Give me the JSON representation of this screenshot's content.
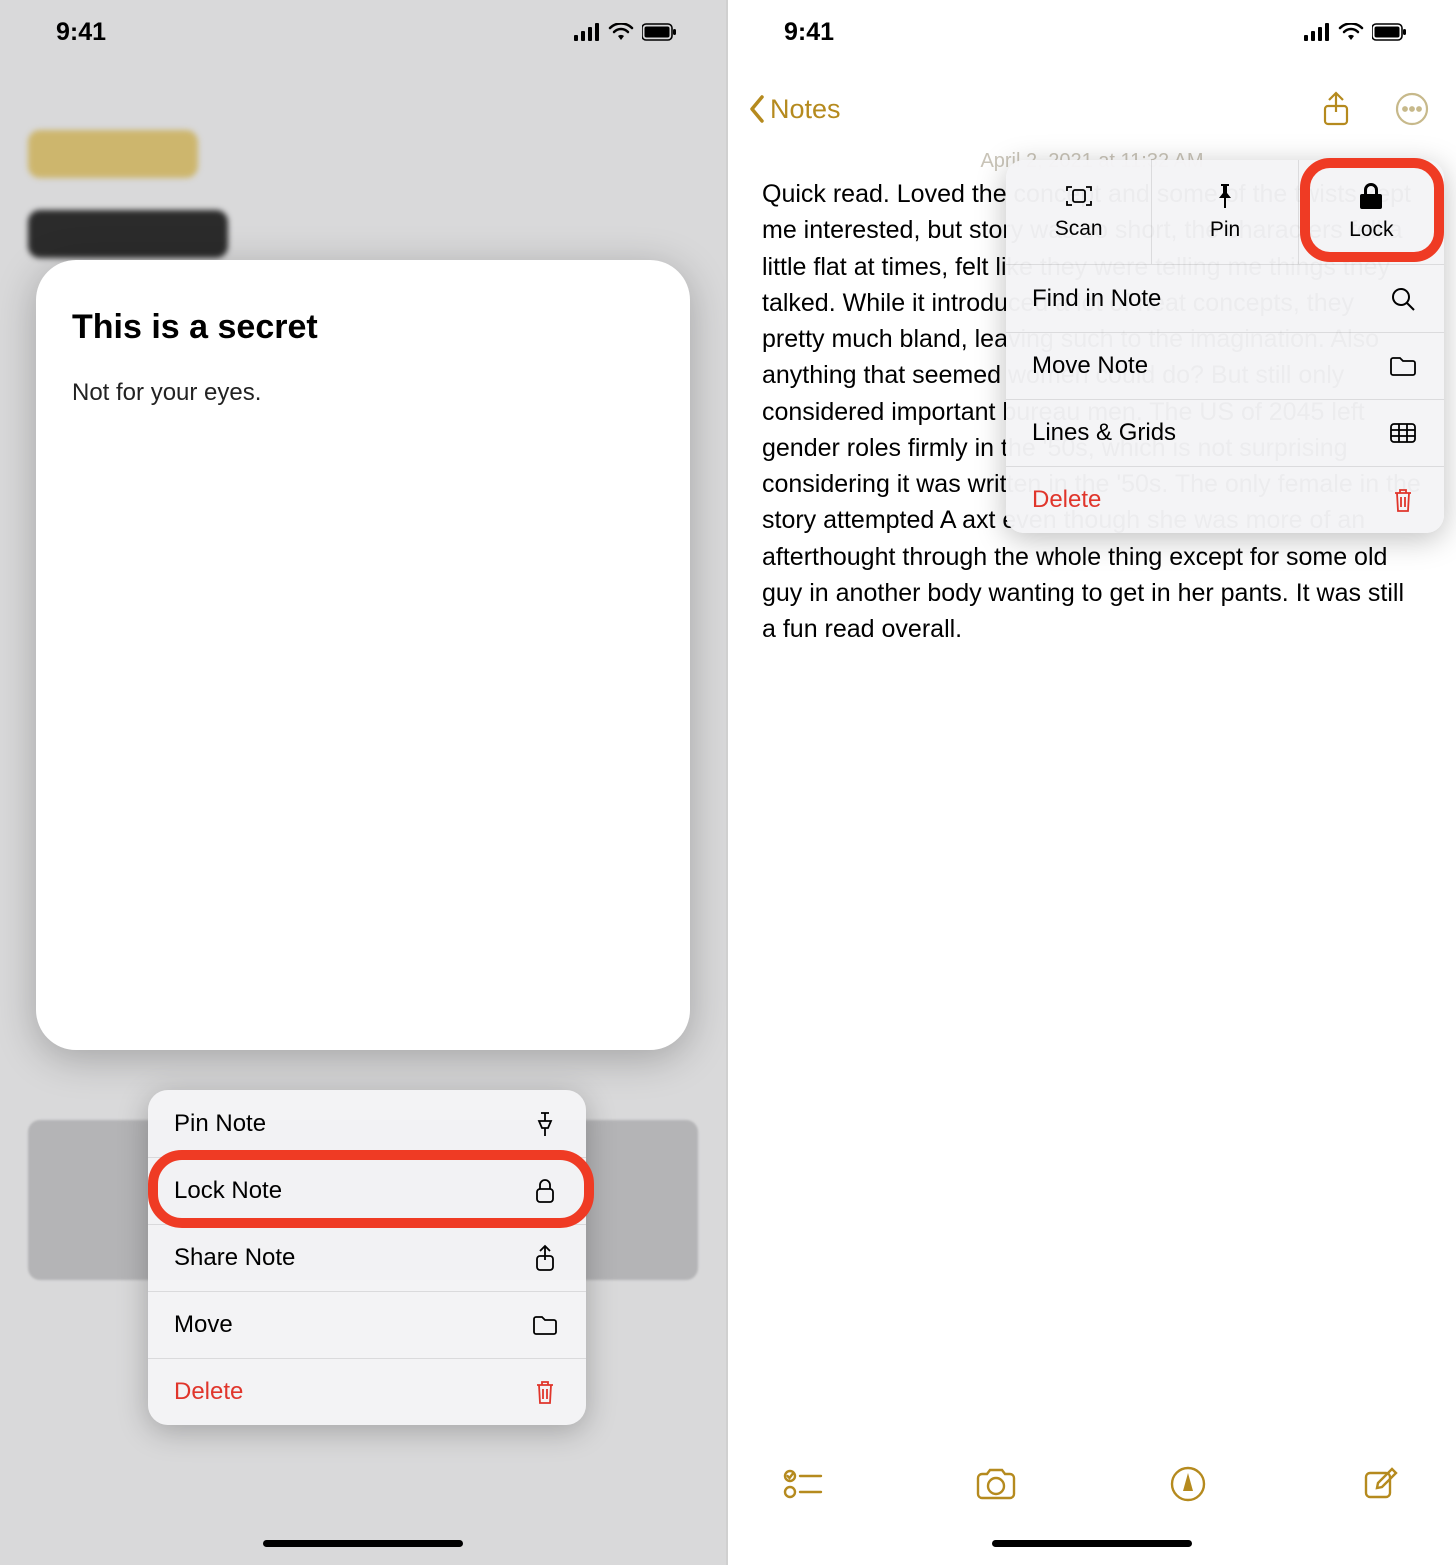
{
  "status_time": "9:41",
  "left": {
    "note_title": "This is a secret",
    "note_body": "Not for your eyes.",
    "menu": {
      "pin": "Pin Note",
      "lock": "Lock Note",
      "share": "Share Note",
      "move": "Move",
      "delete": "Delete"
    }
  },
  "right": {
    "back_label": "Notes",
    "date_stamp": "April 2, 2021 at 11:32 AM",
    "note_body": "Quick read. Loved the concept and some of the twists kept me interested, but story was so short, the characters fell a little flat at times, felt like they were telling me things they talked. While it introduced a lot of neat concepts, they pretty much bland, leaving such to the imagination. Also anything that seemed women could do? But still only considered important bureau men. The US of 2045 left gender roles firmly in the '50s, which is not surprising considering it was written in the '50s. The only female in the story attempted A axt even though she was more of an afterthought through the whole thing except for some old guy in another body wanting to get in her pants. It was still a fun read overall.",
    "popover": {
      "scan": "Scan",
      "pin": "Pin",
      "lock": "Lock",
      "find": "Find in Note",
      "move": "Move Note",
      "lines": "Lines & Grids",
      "delete": "Delete"
    }
  }
}
